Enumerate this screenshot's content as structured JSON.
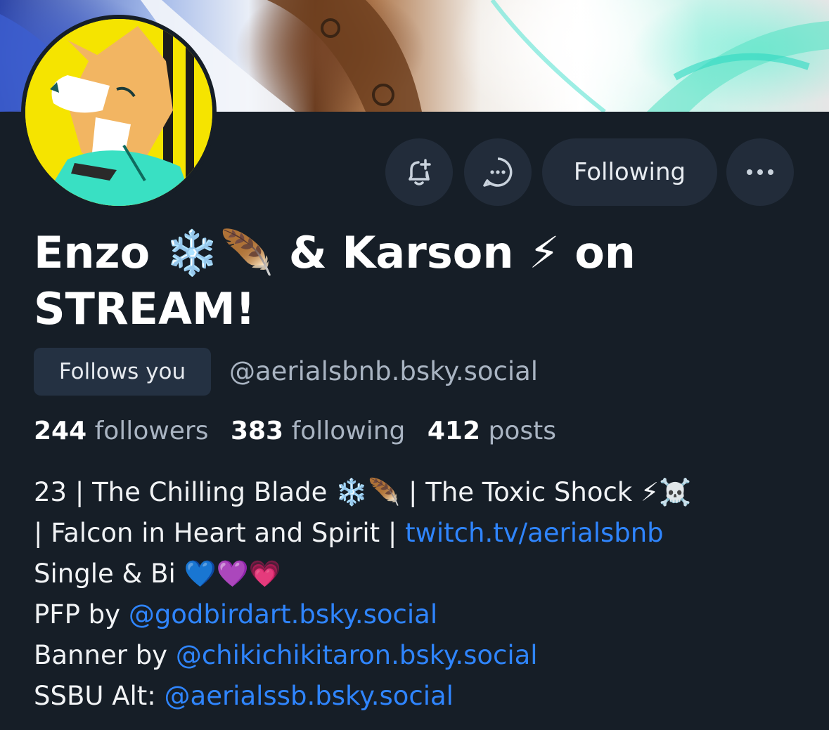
{
  "profile": {
    "display_name_line1": "Enzo ❄️🪶 & Karson ⚡ on",
    "display_name_line2": "STREAM!",
    "follows_you_label": "Follows you",
    "handle": "@aerialsbnb.bsky.social"
  },
  "actions": {
    "subscribe_icon": "bell-plus-icon",
    "message_icon": "chat-bubble-icon",
    "following_label": "Following",
    "more_icon": "ellipsis-icon"
  },
  "stats": {
    "followers_count": "244",
    "followers_label": "followers",
    "following_count": "383",
    "following_label": "following",
    "posts_count": "412",
    "posts_label": "posts"
  },
  "bio": {
    "line1": "23 | The Chilling Blade ❄️🪶 | The Toxic Shock ⚡☠️",
    "line2_text": "| Falcon in Heart and Spirit | ",
    "line2_link": "twitch.tv/aerialsbnb",
    "line3": "Single & Bi 💙💜💗",
    "line4_text": "PFP by ",
    "line4_link": "@godbirdart.bsky.social",
    "line5_text": "Banner by ",
    "line5_link": "@chikichikitaron.bsky.social",
    "line6_text": "SSBU Alt: ",
    "line6_link": "@aerialssb.bsky.social"
  },
  "colors": {
    "background": "#161e27",
    "button_bg": "#222c3a",
    "link": "#2f85ff",
    "muted_text": "#a9b4c2"
  }
}
